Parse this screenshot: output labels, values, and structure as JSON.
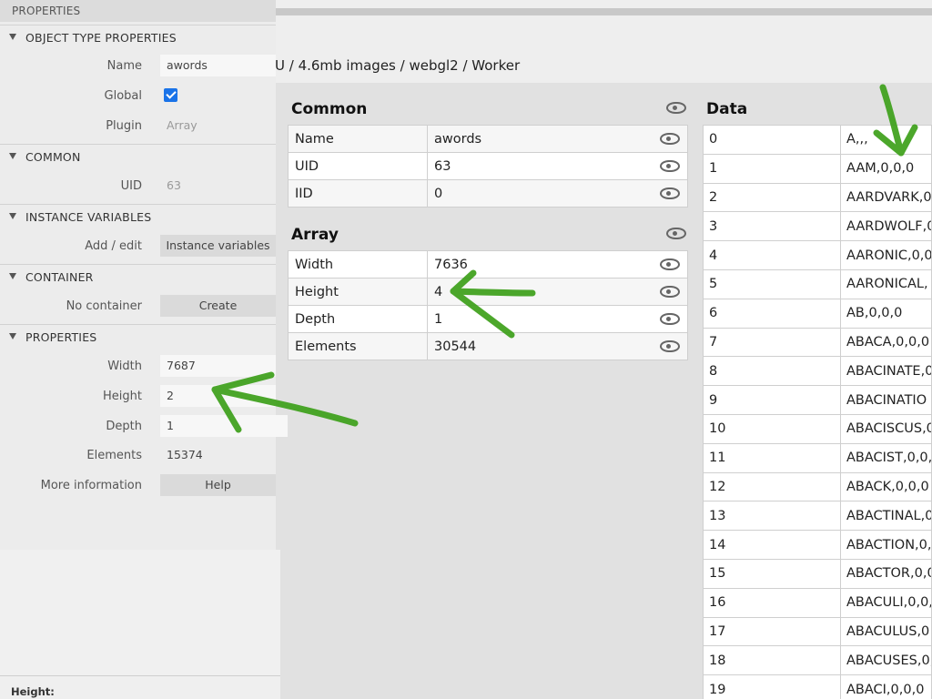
{
  "debugger": {
    "breadcrumb": "U / 4.6mb images / webgl2 / Worker",
    "common": {
      "title": "Common",
      "rows": [
        {
          "key": "Name",
          "value": "awords"
        },
        {
          "key": "UID",
          "value": "63"
        },
        {
          "key": "IID",
          "value": "0"
        }
      ]
    },
    "array": {
      "title": "Array",
      "rows": [
        {
          "key": "Width",
          "value": "7636"
        },
        {
          "key": "Height",
          "value": "4"
        },
        {
          "key": "Depth",
          "value": "1"
        },
        {
          "key": "Elements",
          "value": "30544"
        }
      ]
    },
    "data": {
      "title": "Data",
      "rows": [
        {
          "key": "0",
          "value": "A,,,"
        },
        {
          "key": "1",
          "value": "AAM,0,0,0"
        },
        {
          "key": "2",
          "value": "AARDVARK,0"
        },
        {
          "key": "3",
          "value": "AARDWOLF,0"
        },
        {
          "key": "4",
          "value": "AARONIC,0,0"
        },
        {
          "key": "5",
          "value": "AARONICAL,"
        },
        {
          "key": "6",
          "value": "AB,0,0,0"
        },
        {
          "key": "7",
          "value": "ABACA,0,0,0"
        },
        {
          "key": "8",
          "value": "ABACINATE,0"
        },
        {
          "key": "9",
          "value": "ABACINATIO"
        },
        {
          "key": "10",
          "value": "ABACISCUS,0"
        },
        {
          "key": "11",
          "value": "ABACIST,0,0,0"
        },
        {
          "key": "12",
          "value": "ABACK,0,0,0"
        },
        {
          "key": "13",
          "value": "ABACTINAL,0"
        },
        {
          "key": "14",
          "value": "ABACTION,0,0"
        },
        {
          "key": "15",
          "value": "ABACTOR,0,0"
        },
        {
          "key": "16",
          "value": "ABACULI,0,0,"
        },
        {
          "key": "17",
          "value": "ABACULUS,0"
        },
        {
          "key": "18",
          "value": "ABACUSES,0,"
        },
        {
          "key": "19",
          "value": "ABACI,0,0,0"
        }
      ]
    }
  },
  "properties": {
    "header": "PROPERTIES",
    "object_type": {
      "title": "OBJECT TYPE PROPERTIES",
      "name_label": "Name",
      "name_value": "awords",
      "global_label": "Global",
      "global_checked": true,
      "plugin_label": "Plugin",
      "plugin_value": "Array"
    },
    "common": {
      "title": "COMMON",
      "uid_label": "UID",
      "uid_value": "63"
    },
    "instance_vars": {
      "title": "INSTANCE VARIABLES",
      "label": "Add / edit",
      "button": "Instance variables"
    },
    "container": {
      "title": "CONTAINER",
      "label": "No container",
      "button": "Create"
    },
    "props": {
      "title": "PROPERTIES",
      "width_label": "Width",
      "width_value": "7687",
      "height_label": "Height",
      "height_value": "2",
      "depth_label": "Depth",
      "depth_value": "1",
      "elements_label": "Elements",
      "elements_value": "15374",
      "more_label": "More information",
      "more_button": "Help"
    },
    "footer": "Height:"
  },
  "colors": {
    "annotation": "#3da01a",
    "checkbox": "#1a73e8"
  }
}
